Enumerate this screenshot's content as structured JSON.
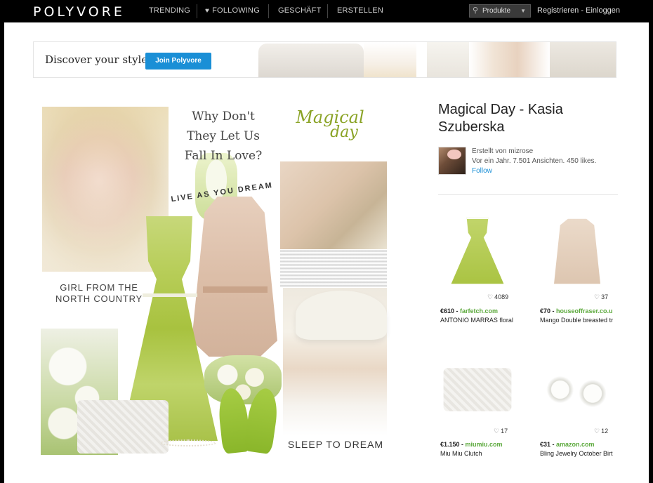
{
  "nav": {
    "logo": "POLYVORE",
    "items": [
      {
        "label": "TRENDING"
      },
      {
        "label": "FOLLOWING"
      },
      {
        "label": "GESCHÄFT"
      },
      {
        "label": "ERSTELLEN"
      }
    ],
    "search_scope": "Produkte",
    "register": "Registrieren",
    "separator": "-",
    "login": "Einloggen"
  },
  "banner": {
    "text": "Discover your style",
    "button": "Join Polyvore"
  },
  "collage": {
    "text_girl": "GIRL FROM THE NORTH COUNTRY",
    "text_why": "Why Don't They Let Us Fall In Love?",
    "text_magical_1": "Magical",
    "text_magical_2": "day",
    "text_live": "LIVE AS YOU DREAM",
    "text_sleep": "SLEEP TO DREAM"
  },
  "set": {
    "title": "Magical Day - Kasia Szuberska",
    "created_by": "Erstellt von mizrose",
    "stats": "Vor ein Jahr. 7.501 Ansichten. 450 likes.",
    "follow": "Follow"
  },
  "products": [
    {
      "likes": "4089",
      "price": "€610",
      "shop": "farfetch.com",
      "name": "ANTONIO MARRAS floral"
    },
    {
      "likes": "37",
      "price": "€70",
      "shop": "houseoffraser.co.u",
      "name": "Mango Double breasted tr"
    },
    {
      "likes": "17",
      "price": "€1.150",
      "shop": "miumiu.com",
      "name": "Miu Miu Clutch"
    },
    {
      "likes": "12",
      "price": "€31",
      "shop": "amazon.com",
      "name": "Bling Jewelry October Birt"
    }
  ]
}
